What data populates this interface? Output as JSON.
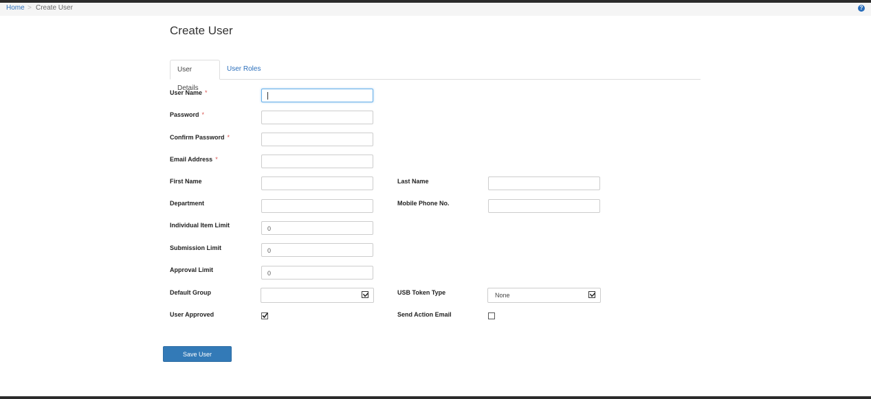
{
  "breadcrumb": {
    "home": "Home",
    "separator": ">",
    "current": "Create User"
  },
  "help_icon": "help-icon",
  "page": {
    "title": "Create User"
  },
  "tabs": [
    {
      "label": "User Details",
      "active": true
    },
    {
      "label": "User Roles",
      "active": false
    }
  ],
  "fields": {
    "user_name": {
      "label": "User Name",
      "required": "*",
      "value": ""
    },
    "password": {
      "label": "Password",
      "required": "*",
      "value": ""
    },
    "confirm_password": {
      "label": "Confirm Password",
      "required": "*",
      "value": ""
    },
    "email": {
      "label": "Email Address",
      "required": "*",
      "value": ""
    },
    "first_name": {
      "label": "First Name",
      "value": ""
    },
    "last_name": {
      "label": "Last Name",
      "value": ""
    },
    "department": {
      "label": "Department",
      "value": ""
    },
    "mobile": {
      "label": "Mobile Phone No.",
      "value": ""
    },
    "item_limit": {
      "label": "Individual Item Limit",
      "value": "0"
    },
    "submission_limit": {
      "label": "Submission Limit",
      "value": "0"
    },
    "approval_limit": {
      "label": "Approval Limit",
      "value": "0"
    },
    "default_group": {
      "label": "Default Group",
      "value": ""
    },
    "usb_token_type": {
      "label": "USB Token Type",
      "value": "None"
    },
    "user_approved": {
      "label": "User Approved",
      "checked": true
    },
    "send_action_email": {
      "label": "Send Action Email",
      "checked": false
    }
  },
  "actions": {
    "save": "Save User"
  },
  "colors": {
    "accent": "#337ab7",
    "link": "#2a6ebb",
    "required": "#d9534f"
  }
}
